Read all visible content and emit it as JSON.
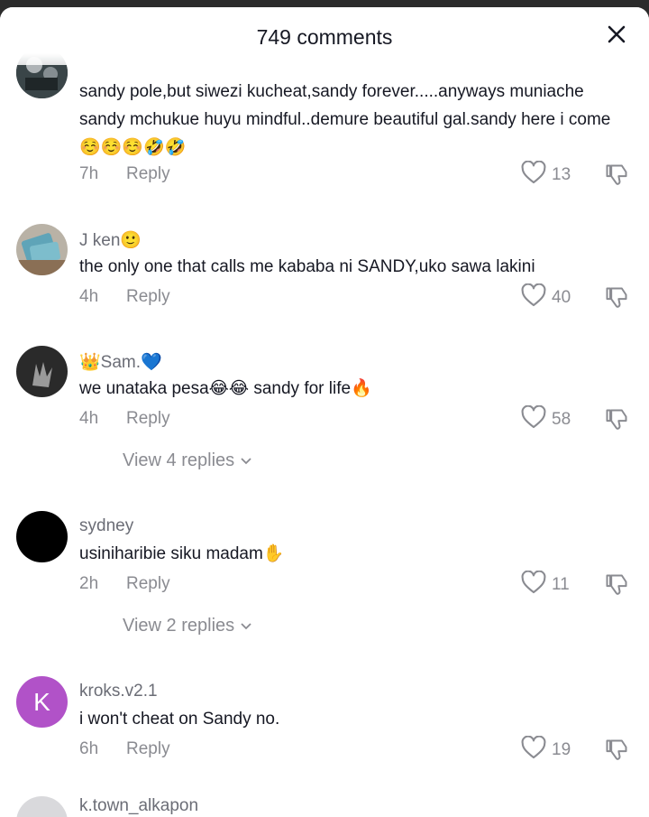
{
  "header": {
    "title": "749 comments"
  },
  "comments": [
    {
      "username": "",
      "text": "sandy pole,but siwezi kucheat,sandy forever.....anyways muniache sandy mchukue huyu mindful..demure beautiful gal.sandy here i come☺️☺️☺️🤣🤣",
      "time": "7h",
      "reply": "Reply",
      "likes": "13"
    },
    {
      "username": "J ken🙂",
      "text": "the only one that calls me kababa ni SANDY,uko sawa lakini",
      "time": "4h",
      "reply": "Reply",
      "likes": "40"
    },
    {
      "username": "👑Sam.💙",
      "text": "we unataka pesa😂😂 sandy for life🔥",
      "time": "4h",
      "reply": "Reply",
      "likes": "58",
      "view_replies": "View 4 replies"
    },
    {
      "username": "sydney",
      "text": "usiniharibie siku madam✋",
      "time": "2h",
      "reply": "Reply",
      "likes": "11",
      "view_replies": "View 2 replies"
    },
    {
      "username": "kroks.v2.1",
      "avatar_letter": "K",
      "text": "i won't cheat on Sandy no.",
      "time": "6h",
      "reply": "Reply",
      "likes": "19"
    },
    {
      "username": "k.town_alkapon",
      "text": "",
      "time": "",
      "reply": "",
      "likes": ""
    }
  ],
  "colors": {
    "avatar_k": "#b152c8",
    "secondary_text": "#8a8b91"
  },
  "icons": [
    "close-icon",
    "heart-outline-icon",
    "dislike-icon",
    "chevron-down-icon"
  ]
}
